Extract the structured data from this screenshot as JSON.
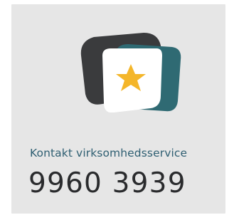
{
  "card": {
    "label": "Kontakt virksomhedsservice",
    "phone": "9960 3939"
  },
  "colors": {
    "background": "#e6e6e6",
    "dark_shape": "#3a3b3d",
    "teal_shape": "#2f6a73",
    "inner_card": "#ffffff",
    "star": "#f4b62a",
    "label_text": "#2f5f72",
    "phone_text": "#2a2b2d"
  },
  "icons": {
    "logo": "star-on-stacked-cards-icon",
    "star": "star-icon"
  }
}
